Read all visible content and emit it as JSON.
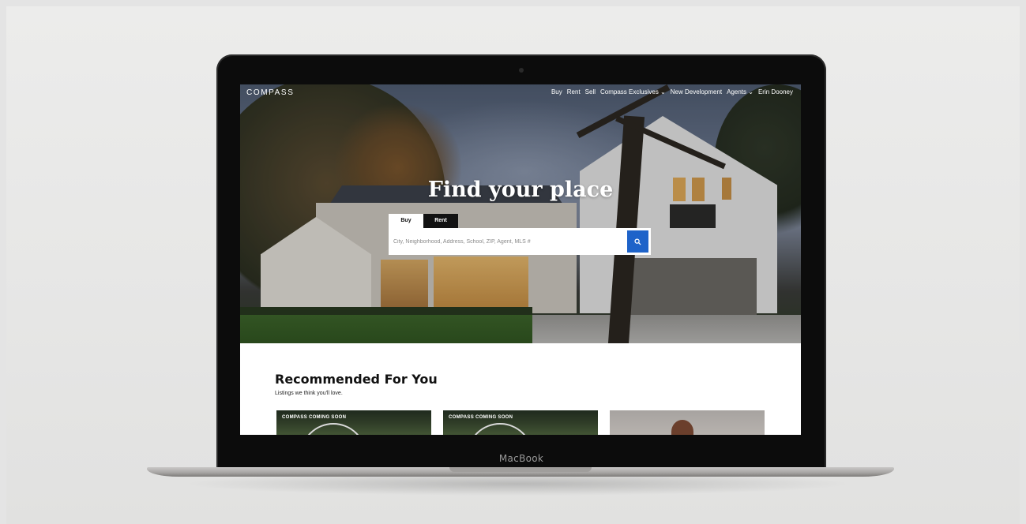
{
  "nav": {
    "logo": "COMPASS",
    "links": [
      {
        "label": "Buy"
      },
      {
        "label": "Rent"
      },
      {
        "label": "Sell"
      },
      {
        "label": "Compass Exclusives ⌄"
      },
      {
        "label": "New Development"
      },
      {
        "label": "Agents ⌄"
      },
      {
        "label": "Erin Dooney"
      }
    ]
  },
  "hero": {
    "headline": "Find your place"
  },
  "search": {
    "tabs": [
      {
        "label": "Buy",
        "active": true
      },
      {
        "label": "Rent",
        "active": false
      }
    ],
    "placeholder": "City, Neighborhood, Address, School, ZIP, Agent, MLS #",
    "button_icon": "search-icon",
    "accent_color": "#1e63c9"
  },
  "recommended": {
    "title": "Recommended For You",
    "subtitle": "Listings we think you'll love.",
    "cards": [
      {
        "tag": "COMPASS COMING SOON"
      },
      {
        "tag": "COMPASS COMING SOON"
      },
      {
        "tag": ""
      }
    ]
  },
  "device": {
    "brand": "MacBook"
  }
}
